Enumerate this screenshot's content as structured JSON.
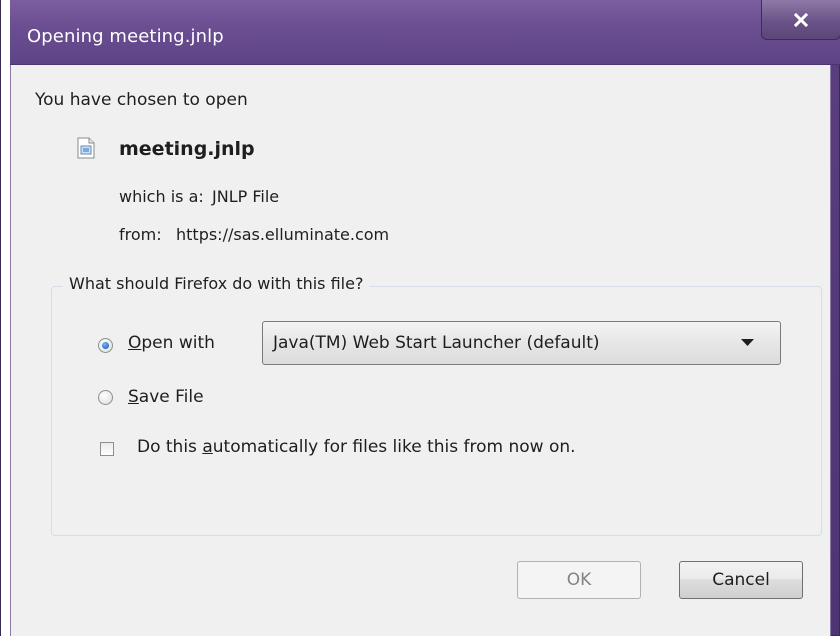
{
  "window": {
    "title": "Opening meeting.jnlp",
    "close_symbol": "x",
    "accent_color": "#6b4f92"
  },
  "prompt": {
    "intro": "You have chosen to open",
    "file_icon": "jnlp-file-icon",
    "file_name": "meeting.jnlp",
    "which_is_label": "which is a:",
    "which_is_value": "JNLP File",
    "from_label": "from:",
    "from_value": "https://sas.elluminate.com"
  },
  "action_group": {
    "legend": "What should Firefox do with this file?",
    "open_with": {
      "prefix": "",
      "accel": "O",
      "rest": "pen with",
      "checked": true
    },
    "application": {
      "selected": "Java(TM) Web Start Launcher (default)"
    },
    "save_file": {
      "accel": "S",
      "rest": "ave File",
      "checked": false
    },
    "auto": {
      "prefix": "Do this ",
      "accel": "a",
      "rest": "utomatically for files like this from now on.",
      "checked": false
    }
  },
  "buttons": {
    "ok": "OK",
    "cancel": "Cancel"
  }
}
